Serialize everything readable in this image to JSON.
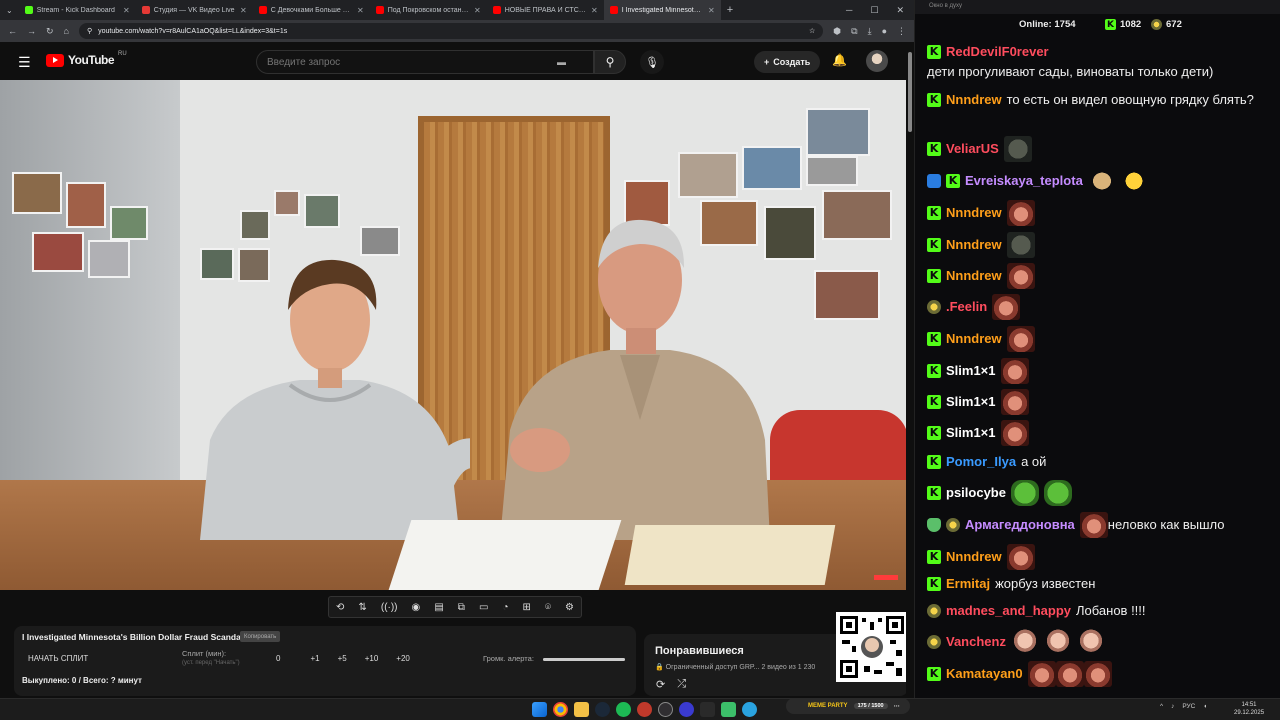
{
  "browser": {
    "tabs": [
      {
        "title": "Stream - Kick Dashboard",
        "color": "#53fc18"
      },
      {
        "title": "Студия — VK Видео Live",
        "color": "#e53935"
      },
      {
        "title": "С Девочками Больше Не Хочу",
        "color": "#ff0000"
      },
      {
        "title": "Под Покровском остановлено",
        "color": "#ff0000"
      },
      {
        "title": "НОВЫЕ ПРАВА И СТС 2026: же",
        "color": "#ff0000"
      },
      {
        "title": "I Investigated Minnesota's Billion",
        "color": "#ff0000"
      }
    ],
    "url": "youtube.com/watch?v=r8AulCA1aOQ&list=LL&index=3&t=1s"
  },
  "youtube": {
    "logo_text": "YouTube",
    "region": "RU",
    "search_placeholder": "Введите запрос",
    "create_label": "Создать"
  },
  "player": {
    "video_title": "I Investigated Minnesota's Billion Dollar Fraud Scandal",
    "copy_label": "Копировать",
    "split_button": "НАЧАТЬ СПЛИТ",
    "split_label": "Сплит (мин):",
    "split_sub": "(уст. перед \"Начать\")",
    "split_values": [
      "0",
      "+1",
      "+5",
      "+10",
      "+20"
    ],
    "alert_label": "Громк. алерта:",
    "alert_volume": 1.0,
    "bought_text": "Выкуплено: 0 / Всего: ? минут"
  },
  "playlist": {
    "title": "Понравившиеся",
    "access": "Ограниченный доступ GRP...",
    "count": "2 видео из 1 230"
  },
  "chat": {
    "window_title": "Окно в духу",
    "online_label": "Online:",
    "online_count": "1754",
    "count1": "1082",
    "count2": "672",
    "messages": [
      {
        "user": "RedDevilF0rever",
        "color": "#ff4d5e",
        "text": "дети прогуливают сады, виноваты только дети)"
      },
      {
        "user": "Nnndrew",
        "color": "#ff9f1a",
        "text": "то есть он видел овощную грядку блять?"
      },
      {
        "user": "VeliarUS",
        "color": "#ff4d5e",
        "text": ""
      },
      {
        "user": "Evreiskaya_teplota",
        "color": "#c58cff",
        "text": ""
      },
      {
        "user": "Nnndrew",
        "color": "#ff9f1a",
        "text": ""
      },
      {
        "user": "Nnndrew",
        "color": "#ff9f1a",
        "text": ""
      },
      {
        "user": "Nnndrew",
        "color": "#ff9f1a",
        "text": ""
      },
      {
        "user": ".Feelin",
        "color": "#ff4d5e",
        "text": ""
      },
      {
        "user": "Nnndrew",
        "color": "#ff9f1a",
        "text": ""
      },
      {
        "user": "Slim1×1",
        "color": "#ffffff",
        "text": ""
      },
      {
        "user": "Slim1×1",
        "color": "#ffffff",
        "text": ""
      },
      {
        "user": "Slim1×1",
        "color": "#ffffff",
        "text": ""
      },
      {
        "user": "Pomor_Ilya",
        "color": "#3a9bff",
        "text": "а ой"
      },
      {
        "user": "psilocybe",
        "color": "#ffffff",
        "text": ""
      },
      {
        "user": "Армагеддоновна",
        "color": "#c58cff",
        "text": "неловко как вышло"
      },
      {
        "user": "Nnndrew",
        "color": "#ff9f1a",
        "text": ""
      },
      {
        "user": "Ermitaj",
        "color": "#ff9f1a",
        "text": "жорбуз известен"
      },
      {
        "user": "madnes_and_happy",
        "color": "#ff4d5e",
        "text": "Лобанов !!!!"
      },
      {
        "user": "Vanchenz",
        "color": "#ff4d5e",
        "text": ""
      },
      {
        "user": "Kamatayan0",
        "color": "#ff9f1a",
        "text": ""
      }
    ]
  },
  "overlay": {
    "meme_label": "MEME PARTY",
    "meme_progress": "175 / 1500"
  },
  "taskbar": {
    "lang": "РУС",
    "time": "14:51",
    "date": "29.12.2025"
  }
}
